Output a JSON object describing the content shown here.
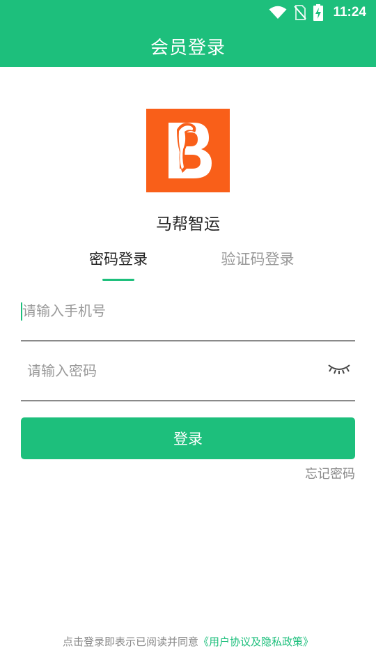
{
  "status_bar": {
    "time": "11:24",
    "icons": [
      "wifi-icon",
      "no-sim-icon",
      "battery-charging-icon"
    ]
  },
  "header": {
    "title": "会员登录"
  },
  "brand": {
    "logo_icon": "horse-b-logo-icon",
    "name": "马帮智运",
    "logo_color": "#f95f19"
  },
  "tabs": [
    {
      "label": "密码登录",
      "active": true
    },
    {
      "label": "验证码登录",
      "active": false
    }
  ],
  "form": {
    "phone_placeholder": "请输入手机号",
    "phone_value": "",
    "password_placeholder": "请输入密码",
    "password_value": "",
    "toggle_icon": "eye-closed-icon",
    "login_label": "登录",
    "forgot_label": "忘记密码"
  },
  "footer": {
    "agreement_text": "点击登录即表示已阅读并同意",
    "agreement_link": "《用户协议及隐私政策》"
  },
  "colors": {
    "primary": "#1dbf7c",
    "logo": "#f95f19"
  }
}
